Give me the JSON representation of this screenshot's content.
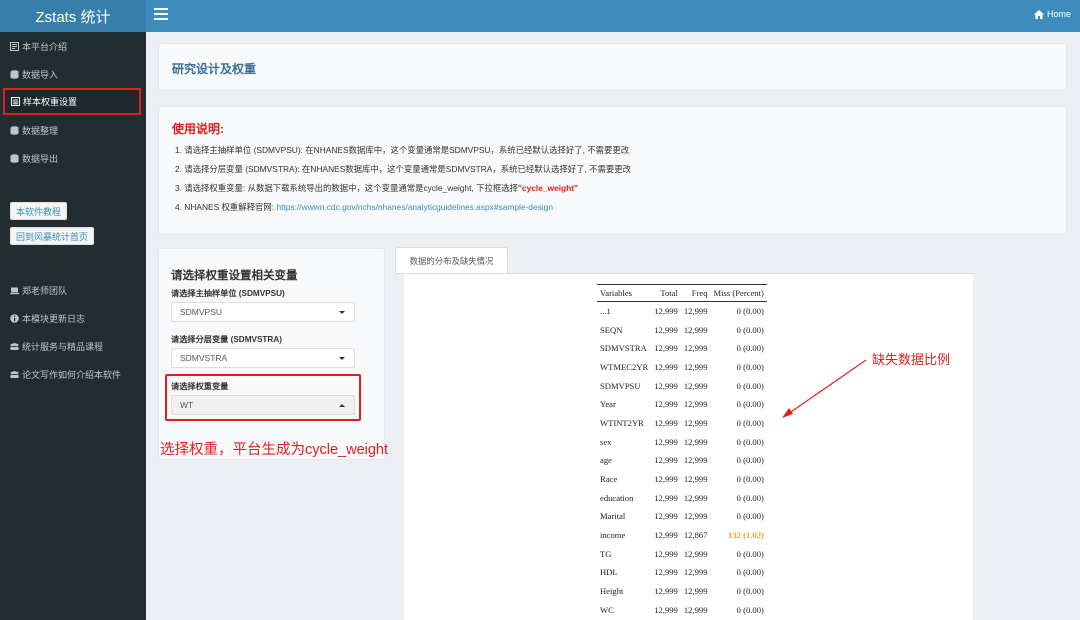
{
  "app": {
    "logo": "Zstats 统计",
    "home_label": "Home"
  },
  "sidebar": {
    "items": [
      {
        "label": "本平台介绍",
        "icon": "file-icon"
      },
      {
        "label": "数据导入",
        "icon": "database-icon"
      },
      {
        "label": "样本权重设置",
        "icon": "list-alt-icon"
      },
      {
        "label": "数据整理",
        "icon": "database-icon"
      },
      {
        "label": "数据导出",
        "icon": "database-icon"
      }
    ],
    "buttons": [
      "本软件教程",
      "回到风暴统计首页"
    ],
    "links": [
      {
        "label": "郑老师团队",
        "icon": "laptop-icon"
      },
      {
        "label": "本模块更新日志",
        "icon": "info-circle-icon"
      },
      {
        "label": "统计服务与精品课程",
        "icon": "users-icon"
      },
      {
        "label": "论文写作如何介绍本软件",
        "icon": "users-icon"
      }
    ]
  },
  "page": {
    "title": "研究设计及权重"
  },
  "usage": {
    "title": "使用说明:",
    "line1": "1. 请选择主抽样单位 (SDMVPSU): 在NHANES数据库中，这个变量通常是SDMVPSU，系统已经默认选择好了, 不需要更改",
    "line2": "2. 请选择分层变量 (SDMVSTRA): 在NHANES数据库中，这个变量通常是SDMVSTRA，系统已经默认选择好了, 不需要更改",
    "line3_prefix": "3. 请选择权重变量: 从数据下载系统导出的数据中，这个变量通常是cycle_weight, 下拉框选择",
    "line3_highlight": "\"cycle_weight\"",
    "line4_prefix": "4. NHANES 权重解释官网: ",
    "line4_link": "https://wwwn.cdc.gov/nchs/nhanes/analyticguidelines.aspx#sample-design"
  },
  "settings": {
    "title": "请选择权重设置相关变量",
    "psu_label": "请选择主抽样单位 (SDMVPSU)",
    "psu_value": "SDMVPSU",
    "strata_label": "请选择分层变量 (SDMVSTRA)",
    "strata_value": "SDMVSTRA",
    "weight_label": "请选择权重变量",
    "weight_value": "WT"
  },
  "annotations": {
    "weight_note": "选择权重，平台生成为cycle_weight",
    "missing_note": "缺失数据比例"
  },
  "tab": {
    "label": "数据的分布及缺失情况"
  },
  "table": {
    "headers": [
      "Variables",
      "Total",
      "Freq",
      "Miss (Percent)"
    ],
    "rows": [
      [
        "...1",
        "12,999",
        "12,999",
        "0 (0.00)"
      ],
      [
        "SEQN",
        "12,999",
        "12,999",
        "0 (0.00)"
      ],
      [
        "SDMVSTRA",
        "12,999",
        "12,999",
        "0 (0.00)"
      ],
      [
        "WTMEC2YR",
        "12,999",
        "12,999",
        "0 (0.00)"
      ],
      [
        "SDMVPSU",
        "12,999",
        "12,999",
        "0 (0.00)"
      ],
      [
        "Year",
        "12,999",
        "12,999",
        "0 (0.00)"
      ],
      [
        "WTINT2YR",
        "12,999",
        "12,999",
        "0 (0.00)"
      ],
      [
        "sex",
        "12,999",
        "12,999",
        "0 (0.00)"
      ],
      [
        "age",
        "12,999",
        "12,999",
        "0 (0.00)"
      ],
      [
        "Race",
        "12,999",
        "12,999",
        "0 (0.00)"
      ],
      [
        "education",
        "12,999",
        "12,999",
        "0 (0.00)"
      ],
      [
        "Marital",
        "12,999",
        "12,999",
        "0 (0.00)"
      ],
      [
        "income",
        "12,999",
        "12,867",
        "132 (1.02)"
      ],
      [
        "TG",
        "12,999",
        "12,999",
        "0 (0.00)"
      ],
      [
        "HDL",
        "12,999",
        "12,999",
        "0 (0.00)"
      ],
      [
        "Height",
        "12,999",
        "12,999",
        "0 (0.00)"
      ],
      [
        "WC",
        "12,999",
        "12,999",
        "0 (0.00)"
      ]
    ]
  },
  "colors": {
    "header": "#3c8dbc",
    "logo_bg": "#367fa9",
    "sidebar": "#222d32",
    "highlight": "#e02020",
    "warning": "#f0a020"
  }
}
